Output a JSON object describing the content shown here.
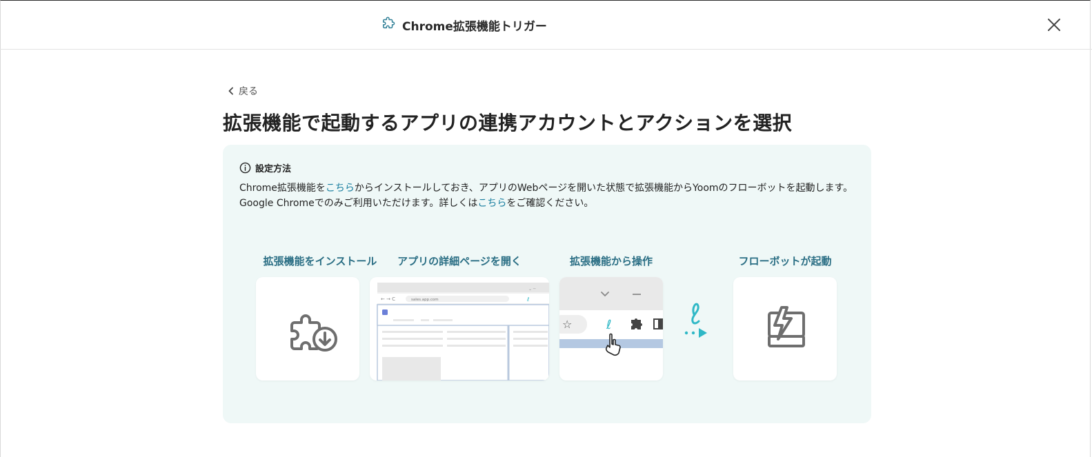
{
  "header": {
    "title": "Chrome拡張機能トリガー",
    "icon": "puzzle-icon",
    "close_icon": "close-icon"
  },
  "back": {
    "label": "戻る",
    "icon": "chevron-left-icon"
  },
  "page_title": "拡張機能で起動するアプリの連携アカウントとアクションを選択",
  "info": {
    "heading": "設定方法",
    "icon": "info-icon",
    "line1_before": "Chrome拡張機能を",
    "line1_link": "こちら",
    "line1_after": "からインストールしておき、アプリのWebページを開いた状態で拡張機能からYoomのフローボットを起動します。",
    "line2_before": "Google Chromeでのみご利用いただけます。詳しくは",
    "line2_link": "こちら",
    "line2_after": "をご確認ください。"
  },
  "steps": [
    {
      "label": "拡張機能をインストール",
      "icon": "puzzle-download-icon"
    },
    {
      "label": "アプリの詳細ページを開く",
      "icon": "browser-page-icon"
    },
    {
      "label": "拡張機能から操作",
      "icon": "browser-toolbar-icon"
    },
    {
      "label": "フローボットが起動",
      "icon": "flowbot-computer-icon"
    }
  ],
  "mock_browser": {
    "url": "sales.app.com"
  },
  "colors": {
    "accent": "#2fb8c6",
    "panel_bg": "#eff8f7",
    "link": "#1a7fa0",
    "step_label": "#2a6e84"
  }
}
